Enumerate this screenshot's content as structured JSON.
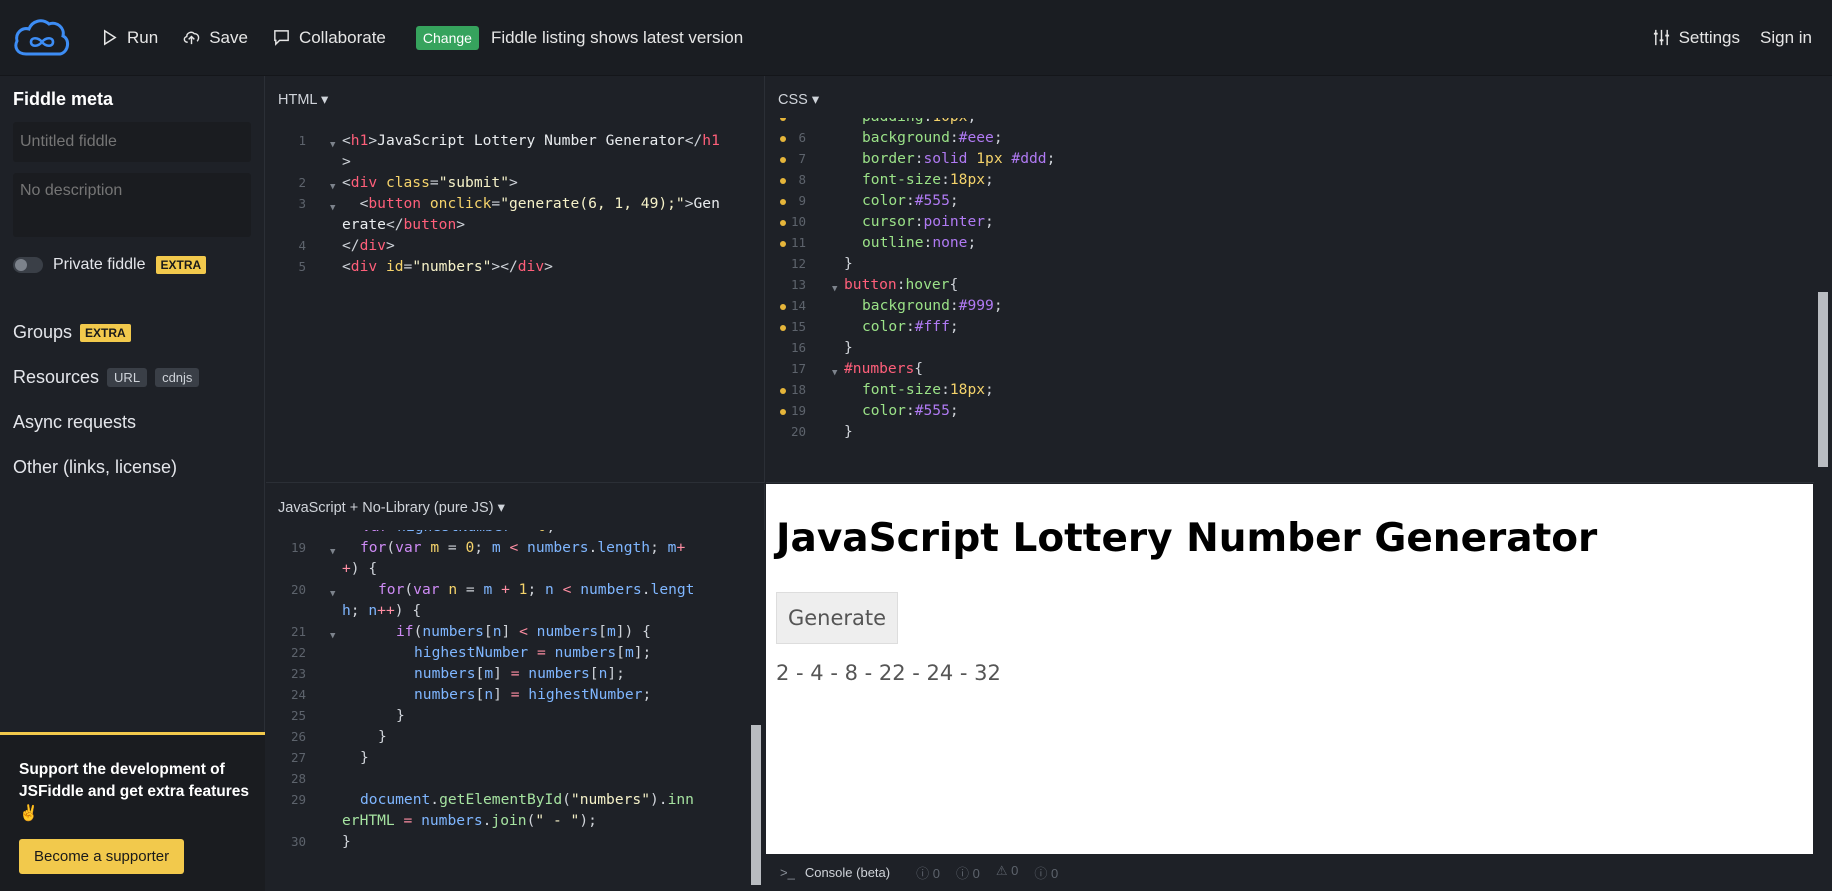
{
  "topbar": {
    "run_label": "Run",
    "save_label": "Save",
    "collaborate_label": "Collaborate",
    "change_badge": "Change",
    "change_msg": "Fiddle listing shows latest version",
    "settings_label": "Settings",
    "signin_label": "Sign in"
  },
  "sidebar": {
    "title": "Fiddle meta",
    "name_placeholder": "Untitled fiddle",
    "desc_placeholder": "No description",
    "private_label": "Private fiddle",
    "extra_badge": "EXTRA",
    "groups_label": "Groups",
    "resources_label": "Resources",
    "url_tag": "URL",
    "cdnjs_tag": "cdnjs",
    "async_label": "Async requests",
    "other_label": "Other (links, license)",
    "support_text": "Support the development of JSFiddle and get extra features ✌",
    "support_button": "Become a supporter"
  },
  "panels": {
    "html_head": "HTML",
    "css_head": "CSS",
    "js_head": "JavaScript + No-Library (pure JS)"
  },
  "result": {
    "heading": "JavaScript Lottery Number Generator",
    "button": "Generate",
    "numbers": "2 - 4 - 8 - 22 - 24 - 32"
  },
  "console": {
    "label": "Console (beta)",
    "count_a": "0",
    "count_b": "0",
    "count_c": "0",
    "count_d": "0"
  },
  "icons": {
    "logo": "jsfiddle-cloud-logo",
    "run": "play-icon",
    "save": "cloud-upload-icon",
    "collaborate": "chat-icon",
    "settings": "sliders-icon"
  },
  "colors": {
    "accent_yellow": "#f2c94c",
    "badge_green": "#36a35d",
    "logo_blue": "#3d8df5"
  }
}
